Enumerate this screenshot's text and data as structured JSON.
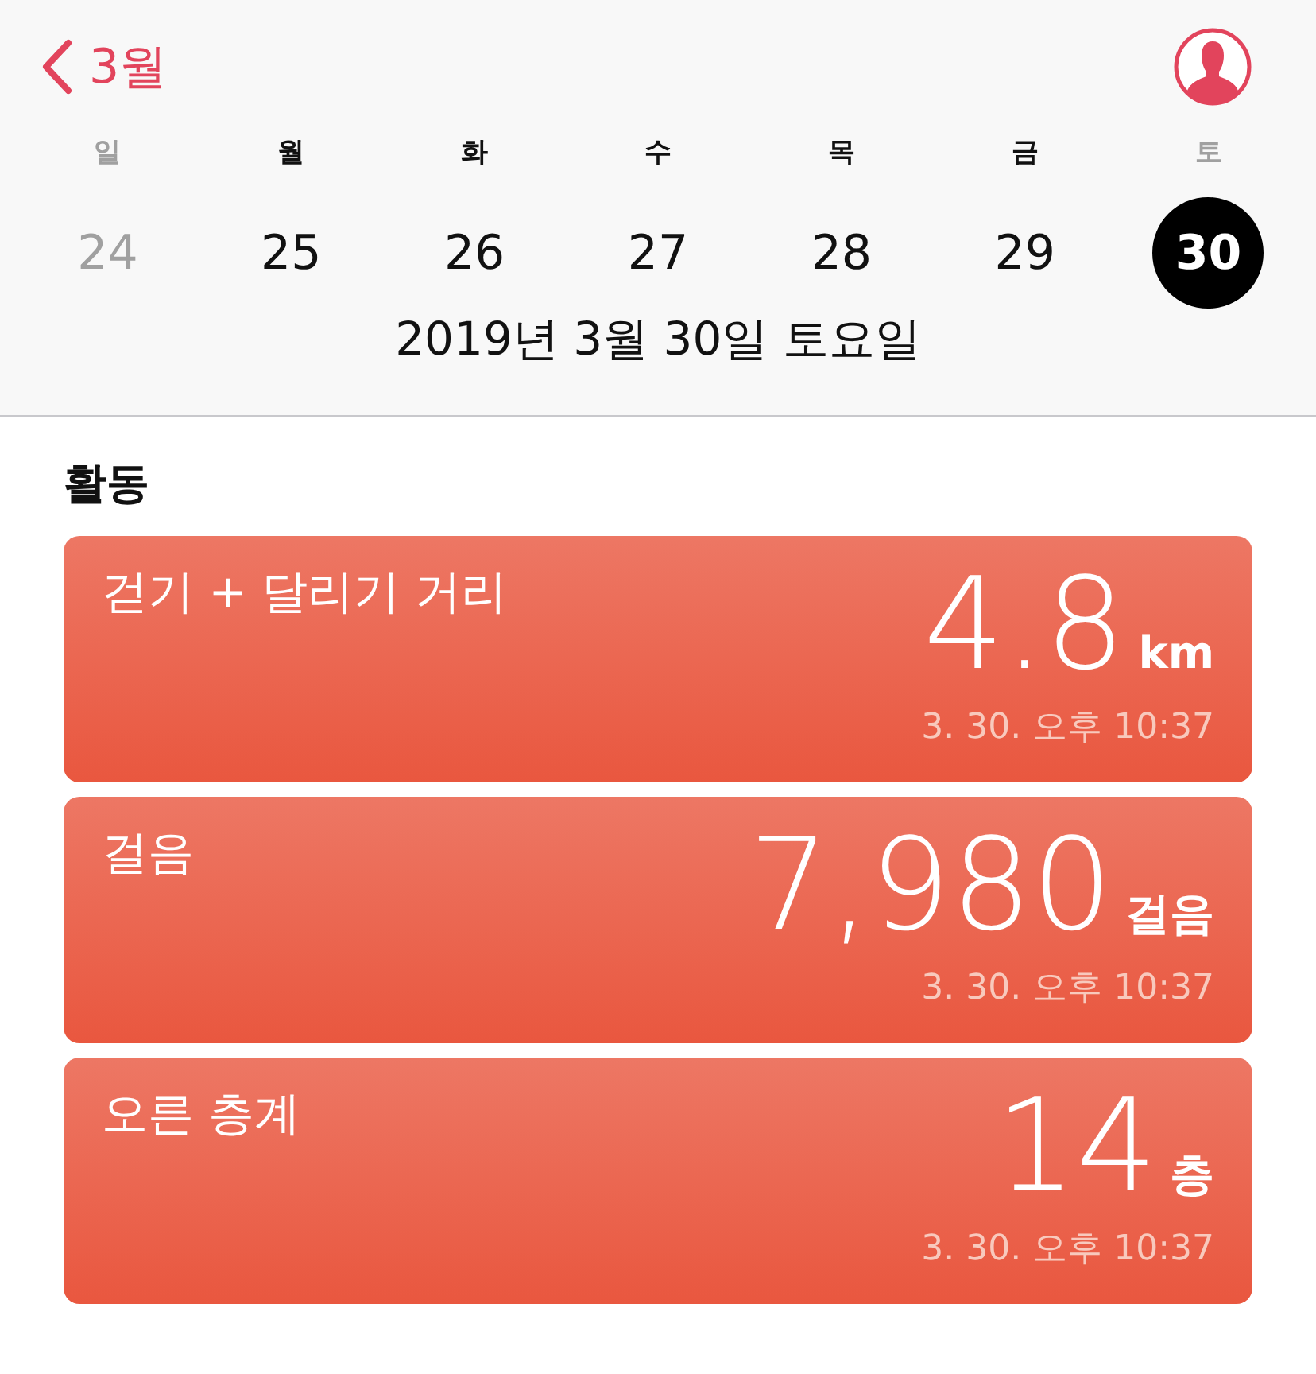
{
  "nav": {
    "back_label": "3월"
  },
  "week": [
    {
      "weekday": "일",
      "date": "24",
      "weekend": true,
      "selected": false
    },
    {
      "weekday": "월",
      "date": "25",
      "weekend": false,
      "selected": false
    },
    {
      "weekday": "화",
      "date": "26",
      "weekend": false,
      "selected": false
    },
    {
      "weekday": "수",
      "date": "27",
      "weekend": false,
      "selected": false
    },
    {
      "weekday": "목",
      "date": "28",
      "weekend": false,
      "selected": false
    },
    {
      "weekday": "금",
      "date": "29",
      "weekend": false,
      "selected": false
    },
    {
      "weekday": "토",
      "date": "30",
      "weekend": true,
      "selected": true
    }
  ],
  "selected_date": "2019년 3월 30일 토요일",
  "section_title": "활동",
  "cards": [
    {
      "title": "걷기 + 달리기 거리",
      "value": "4.8",
      "unit": "km",
      "timestamp": "3. 30. 오후 10:37"
    },
    {
      "title": "걸음",
      "value": "7,980",
      "unit": "걸음",
      "timestamp": "3. 30. 오후 10:37"
    },
    {
      "title": "오른 층계",
      "value": "14",
      "unit": "층",
      "timestamp": "3. 30. 오후 10:37"
    }
  ]
}
